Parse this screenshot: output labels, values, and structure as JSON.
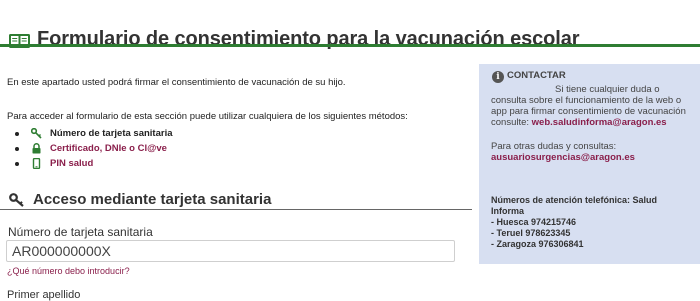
{
  "header": {
    "title": "Formulario de consentimiento para la vacunación escolar",
    "icon": "book-icon",
    "accent_color": "#2e7d32"
  },
  "intro": "En este apartado usted podrá firmar el consentimiento de vacunación de su hijo.",
  "methods_intro": "Para acceder al formulario de esta sección puede utilizar cualquiera de los siguientes métodos:",
  "methods": [
    {
      "label": "Número de tarjeta sanitaria",
      "icon": "key-icon"
    },
    {
      "label": "Certificado, DNIe o Cl@ve",
      "icon": "lock-icon"
    },
    {
      "label": "PIN salud",
      "icon": "mobile-icon"
    }
  ],
  "section": {
    "title": "Acceso mediante tarjeta sanitaria",
    "icon": "key-icon"
  },
  "form": {
    "card_label": "Número de tarjeta sanitaria",
    "card_value": "AR000000000X",
    "help_link": "¿Qué número debo introducir?",
    "next_label_partial": "Primer apellido"
  },
  "contact": {
    "title": "CONTACTAR",
    "lines": [
      "Si tiene cualquier duda o",
      "consulta sobre el funcionamiento de la web o",
      "app para firmar consentimiento de vacunación",
      "consulte:"
    ],
    "email": "web.saludinforma@aragon.es",
    "urgent_label": "Para otras dudas y consultas:",
    "urgent_email": "ausuariosurgencias@aragon.es",
    "phones_title": "Números de atención telefónica: Salud Informa",
    "phones": [
      "- Huesca 974215746",
      "- Teruel 978623345",
      "- Zaragoza 976306841"
    ],
    "background_color": "#d7dff1",
    "link_color": "#8a1f4b"
  }
}
